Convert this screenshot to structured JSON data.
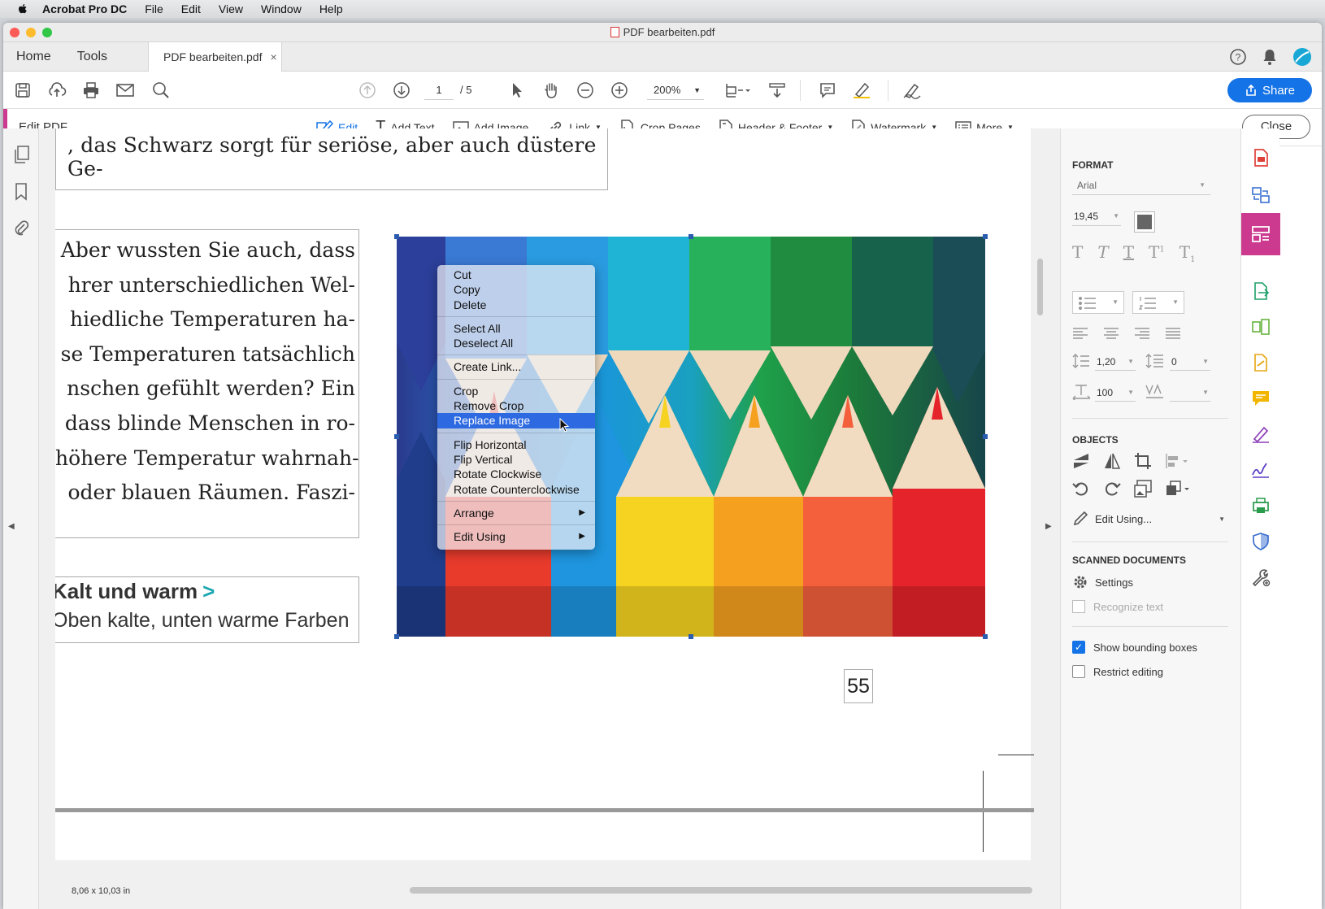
{
  "menubar": {
    "app": "Acrobat Pro DC",
    "items": [
      "File",
      "Edit",
      "View",
      "Window",
      "Help"
    ]
  },
  "window": {
    "title": "PDF bearbeiten.pdf"
  },
  "tabs": {
    "home": "Home",
    "tools": "Tools",
    "doc": "PDF bearbeiten.pdf",
    "close_x": "×"
  },
  "toolbar": {
    "page_current": "1",
    "page_total": "/ 5",
    "zoom": "200%",
    "share": "Share"
  },
  "editbar": {
    "title": "Edit PDF",
    "tools": {
      "edit": "Edit",
      "add_text": "Add Text",
      "add_image": "Add Image",
      "link": "Link",
      "crop_pages": "Crop Pages",
      "header_footer": "Header & Footer",
      "watermark": "Watermark",
      "more": "More"
    },
    "close": "Close"
  },
  "page": {
    "text_top": ", das Schwarz sorgt für seriöse, aber auch düstere Ge-",
    "lines": [
      "Aber wussten Sie auch, dass",
      "hrer unterschiedlichen Wel-",
      "hiedliche Temperaturen ha-",
      "se Temperaturen tatsächlich",
      "nschen gefühlt werden? Ein",
      "dass blinde Menschen in ro-",
      "höhere Temperatur wahrnah-",
      "oder blauen Räumen. Faszi-"
    ],
    "heading": "Kalt und warm",
    "heading_arrow": ">",
    "subheading": "Oben kalte, unten warme Farben",
    "page_number": "55"
  },
  "context_menu": {
    "items": [
      "Cut",
      "Copy",
      "Delete",
      "Select All",
      "Deselect All",
      "Create Link...",
      "Crop",
      "Remove Crop",
      "Replace Image",
      "Flip Horizontal",
      "Flip Vertical",
      "Rotate Clockwise",
      "Rotate Counterclockwise",
      "Arrange",
      "Edit Using"
    ],
    "highlighted": "Replace Image"
  },
  "format_panel": {
    "format_heading": "FORMAT",
    "font": "Arial",
    "font_size": "19,45",
    "line_spacing": "1,20",
    "para_spacing": "0",
    "scale": "100",
    "objects_heading": "OBJECTS",
    "edit_using": "Edit Using...",
    "scanned_heading": "SCANNED DOCUMENTS",
    "settings": "Settings",
    "recognize_text": "Recognize text",
    "show_bounding_boxes": "Show bounding boxes",
    "show_bounding_boxes_checked": true,
    "restrict_editing": "Restrict editing",
    "restrict_editing_checked": false
  },
  "status": {
    "page_size": "8,06 x 10,03 in"
  },
  "colors": {
    "accent": "#1473e6",
    "edit_accent": "#cc3a8f",
    "menu_highlight": "#2d69e0",
    "teal_arrow": "#19a6b0"
  }
}
